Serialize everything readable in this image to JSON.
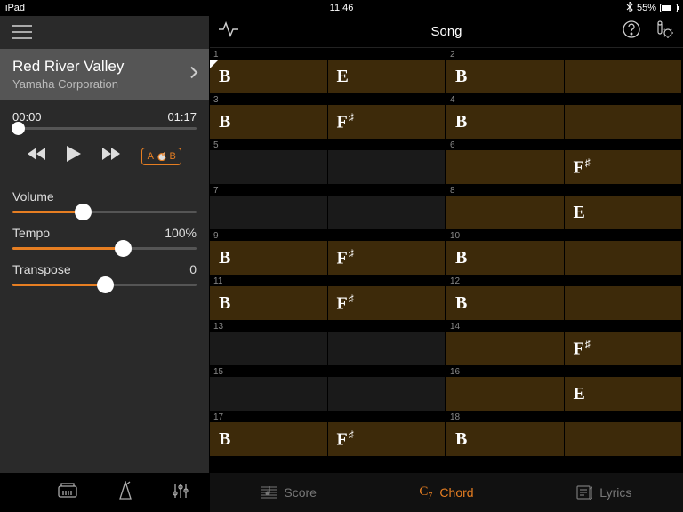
{
  "status": {
    "device": "iPad",
    "time": "11:46",
    "battery_pct": "55%",
    "battery_fill": 55
  },
  "song": {
    "title": "Red River Valley",
    "artist": "Yamaha Corporation"
  },
  "playback": {
    "elapsed": "00:00",
    "total": "01:17",
    "progress_pct": 3,
    "ab_loop": "A⟲B"
  },
  "controls": {
    "volume": {
      "label": "Volume",
      "pct": 38
    },
    "tempo": {
      "label": "Tempo",
      "value": "100%",
      "pct": 60
    },
    "transpose": {
      "label": "Transpose",
      "value": "0",
      "pct": 50
    }
  },
  "header": {
    "title": "Song"
  },
  "bottom_tabs": {
    "score": "Score",
    "chord": "Chord",
    "lyrics": "Lyrics"
  },
  "bars": [
    {
      "n": 1,
      "cells": [
        "B",
        "E"
      ],
      "playhead": true
    },
    {
      "n": 2,
      "cells": [
        "B",
        ""
      ]
    },
    {
      "n": 3,
      "cells": [
        "B",
        "F#"
      ]
    },
    {
      "n": 4,
      "cells": [
        "B",
        ""
      ]
    },
    {
      "n": 5,
      "cells": [
        "",
        ""
      ],
      "dark": true
    },
    {
      "n": 6,
      "cells": [
        "",
        "F#"
      ]
    },
    {
      "n": 7,
      "cells": [
        "",
        ""
      ],
      "dark": true
    },
    {
      "n": 8,
      "cells": [
        "",
        "E"
      ]
    },
    {
      "n": 9,
      "cells": [
        "B",
        "F#"
      ]
    },
    {
      "n": 10,
      "cells": [
        "B",
        ""
      ]
    },
    {
      "n": 11,
      "cells": [
        "B",
        "F#"
      ]
    },
    {
      "n": 12,
      "cells": [
        "B",
        ""
      ]
    },
    {
      "n": 13,
      "cells": [
        "",
        ""
      ],
      "dark": true
    },
    {
      "n": 14,
      "cells": [
        "",
        "F#"
      ]
    },
    {
      "n": 15,
      "cells": [
        "",
        ""
      ],
      "dark": true
    },
    {
      "n": 16,
      "cells": [
        "",
        "E"
      ]
    },
    {
      "n": 17,
      "cells": [
        "B",
        "F#"
      ]
    },
    {
      "n": 18,
      "cells": [
        "B",
        ""
      ]
    }
  ],
  "colors": {
    "accent": "#e67e22",
    "chord_bg": "#3d2a0a"
  }
}
